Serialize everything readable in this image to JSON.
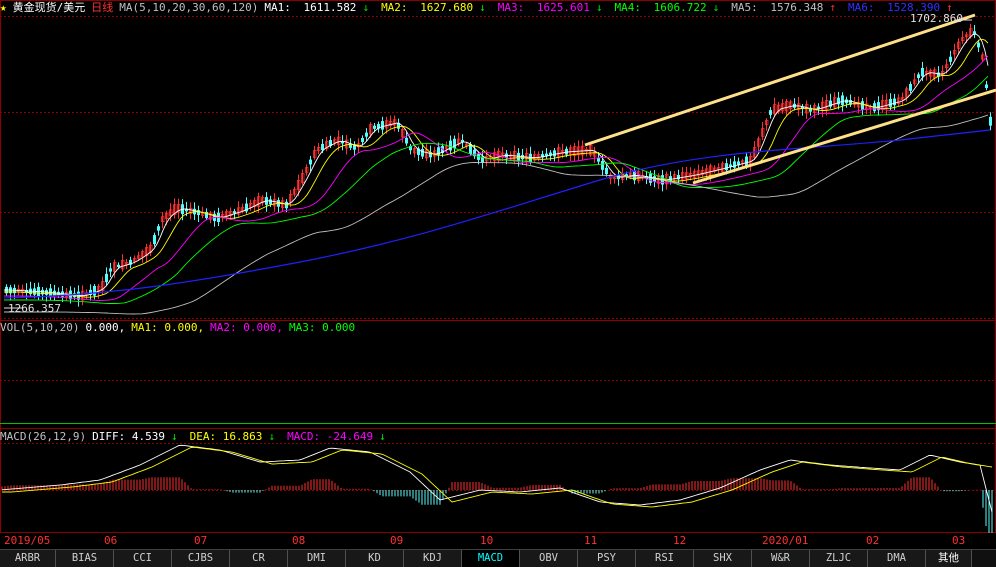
{
  "main_legend": {
    "symbol": "黄金现货/美元",
    "period": "日线",
    "ma_params": "MA(5,10,20,30,60,120)",
    "ma1": {
      "label": "MA1:",
      "value": "1611.582",
      "dir": "down",
      "color": "#ffffff"
    },
    "ma2": {
      "label": "MA2:",
      "value": "1627.680",
      "dir": "down",
      "color": "#ffff00"
    },
    "ma3": {
      "label": "MA3:",
      "value": "1625.601",
      "dir": "down",
      "color": "#ff00ff"
    },
    "ma4": {
      "label": "MA4:",
      "value": "1606.722",
      "dir": "down",
      "color": "#00ff00"
    },
    "ma5": {
      "label": "MA5:",
      "value": "1576.348",
      "dir": "up",
      "color": "#c0c0c0"
    },
    "ma6": {
      "label": "MA6:",
      "value": "1528.390",
      "dir": "up",
      "color": "#2020ff"
    }
  },
  "price_labels": {
    "high": "1702.860",
    "low": "1266.357"
  },
  "vol_legend": {
    "params": "VOL(5,10,20)",
    "vol": "0.000,",
    "ma1": "MA1: 0.000,",
    "ma2": "MA2: 0.000,",
    "ma3": "MA3: 0.000"
  },
  "macd_legend": {
    "params": "MACD(26,12,9)",
    "diff": "DIFF: 4.539",
    "dea": "DEA: 16.863",
    "macd": "MACD: -24.649"
  },
  "months": [
    "2019/05",
    "06",
    "07",
    "08",
    "09",
    "10",
    "11",
    "12",
    "2020/01",
    "02",
    "03"
  ],
  "tabs": [
    "ARBR",
    "BIAS",
    "CCI",
    "CJBS",
    "CR",
    "DMI",
    "KD",
    "KDJ",
    "MACD",
    "OBV",
    "PSY",
    "RSI",
    "SHX",
    "W&R",
    "ZLJC",
    "DMA",
    "其他"
  ],
  "active_tab": "MACD",
  "colors": {
    "up": "#ff3030",
    "down": "#54fcfc",
    "grid": "#8b0000",
    "trendline": "#ffe08a"
  }
}
